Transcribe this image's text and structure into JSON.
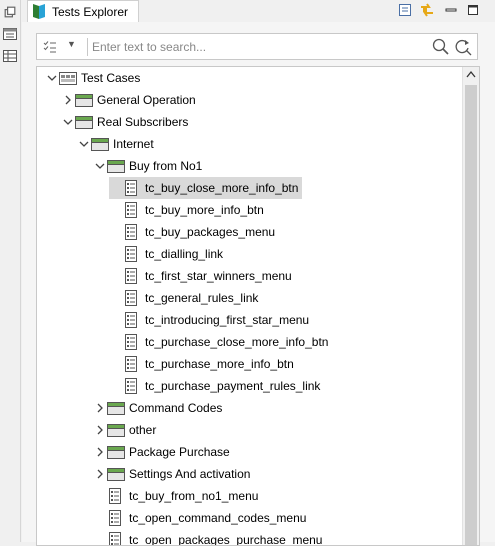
{
  "view": {
    "title": "Tests Explorer"
  },
  "search": {
    "placeholder": "Enter text to search..."
  },
  "tree": {
    "nodes": [
      {
        "label": "Test Cases",
        "type": "root",
        "expanded": true
      },
      {
        "label": "General Operation",
        "type": "folder",
        "expanded": false
      },
      {
        "label": "Real Subscribers",
        "type": "folder",
        "expanded": true
      },
      {
        "label": "Internet",
        "type": "folder",
        "expanded": true
      },
      {
        "label": "Buy from No1",
        "type": "folder",
        "expanded": true
      },
      {
        "label": "tc_buy_close_more_info_btn",
        "type": "testcase",
        "selected": true
      },
      {
        "label": "tc_buy_more_info_btn",
        "type": "testcase"
      },
      {
        "label": "tc_buy_packages_menu",
        "type": "testcase"
      },
      {
        "label": "tc_dialling_link",
        "type": "testcase"
      },
      {
        "label": "tc_first_star_winners_menu",
        "type": "testcase"
      },
      {
        "label": "tc_general_rules_link",
        "type": "testcase"
      },
      {
        "label": "tc_introducing_first_star_menu",
        "type": "testcase"
      },
      {
        "label": "tc_purchase_close_more_info_btn",
        "type": "testcase"
      },
      {
        "label": "tc_purchase_more_info_btn",
        "type": "testcase"
      },
      {
        "label": "tc_purchase_payment_rules_link",
        "type": "testcase"
      },
      {
        "label": "Command Codes",
        "type": "folder",
        "expanded": false
      },
      {
        "label": "other",
        "type": "folder",
        "expanded": false
      },
      {
        "label": "Package Purchase",
        "type": "folder",
        "expanded": false
      },
      {
        "label": "Settings And activation",
        "type": "folder",
        "expanded": false
      },
      {
        "label": "tc_buy_from_no1_menu",
        "type": "testcase"
      },
      {
        "label": "tc_open_command_codes_menu",
        "type": "testcase"
      },
      {
        "label": "tc_open_packages_purchase_menu",
        "type": "testcase"
      }
    ]
  },
  "colors": {
    "folder_tab": "#6aa84f",
    "folder_body": "#e6e6e6",
    "selection": "#d9d9d9",
    "accent_yellow": "#e6a817"
  }
}
